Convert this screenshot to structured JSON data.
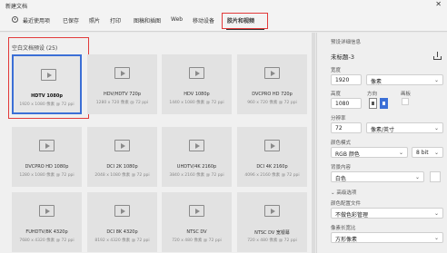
{
  "window": {
    "title": "新建文档",
    "close_glyph": "✕"
  },
  "tabs": [
    {
      "label": "最近使用项"
    },
    {
      "label": "已保存"
    },
    {
      "label": "照片"
    },
    {
      "label": "打印"
    },
    {
      "label": "图稿和插图"
    },
    {
      "label": "Web"
    },
    {
      "label": "移动设备"
    },
    {
      "label": "胶片和视频"
    }
  ],
  "active_tab": "胶片和视频",
  "section": {
    "title": "空白文档预设 (25)"
  },
  "presets": [
    {
      "name": "HDTV 1080p",
      "dims": "1920 x 1080 像素 @ 72 ppi",
      "selected": true
    },
    {
      "name": "HDV/HDTV 720p",
      "dims": "1280 x 720 像素 @ 72 ppi"
    },
    {
      "name": "HDV 1080p",
      "dims": "1440 x 1080 像素 @ 72 ppi"
    },
    {
      "name": "DVCPRO HD 720p",
      "dims": "960 x 720 像素 @ 72 ppi"
    },
    {
      "name": "DVCPRO HD 1080p",
      "dims": "1280 x 1080 像素 @ 72 ppi"
    },
    {
      "name": "DCI 2K 1080p",
      "dims": "2048 x 1080 像素 @ 72 ppi"
    },
    {
      "name": "UHDTV/4K 2160p",
      "dims": "3840 x 2160 像素 @ 72 ppi"
    },
    {
      "name": "DCI 4K 2160p",
      "dims": "4096 x 2160 像素 @ 72 ppi"
    },
    {
      "name": "FUHDTV/8K 4320p",
      "dims": "7680 x 4320 像素 @ 72 ppi"
    },
    {
      "name": "DCI 8K 4320p",
      "dims": "8192 x 4320 像素 @ 72 ppi"
    },
    {
      "name": "NTSC DV",
      "dims": "720 x 480 像素 @ 72 ppi"
    },
    {
      "name": "NTSC DV 宽银幕",
      "dims": "720 x 480 像素 @ 72 ppi"
    }
  ],
  "details": {
    "header": "预设详细信息",
    "doc_name": "未标题-3",
    "width_label": "宽度",
    "width_value": "1920",
    "width_unit": "像素",
    "height_label": "高度",
    "height_value": "1080",
    "orientation_label": "方向",
    "artboard_label": "画板",
    "resolution_label": "分辨率",
    "resolution_value": "72",
    "resolution_unit": "像素/英寸",
    "color_mode_label": "颜色模式",
    "color_mode_value": "RGB 颜色",
    "bit_depth_value": "8 bit",
    "background_label": "背景内容",
    "background_value": "白色",
    "advanced_label": "高级选项",
    "color_profile_label": "颜色配置文件",
    "color_profile_value": "不做色彩管理",
    "pixel_aspect_label": "像素长宽比",
    "pixel_aspect_value": "方形像素"
  },
  "colors": {
    "selected_tile_border": "#3b6fd6",
    "highlight_box": "#e23a3a"
  }
}
